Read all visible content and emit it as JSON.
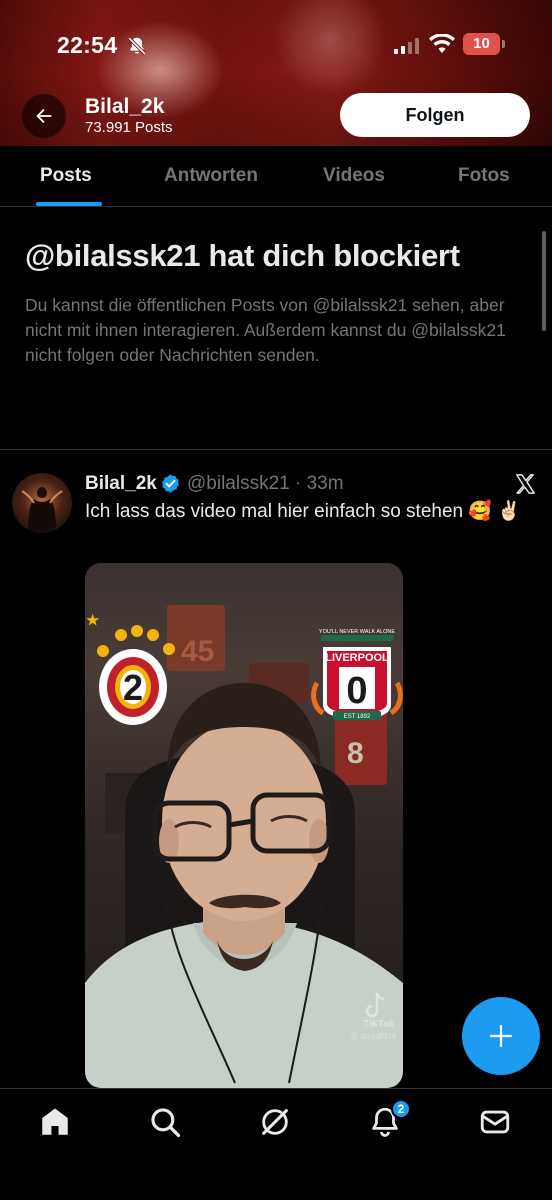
{
  "status_bar": {
    "time": "22:54",
    "battery": "10"
  },
  "header": {
    "name": "Bilal_2k",
    "post_count": "73.991 Posts",
    "follow_label": "Folgen"
  },
  "tabs": [
    {
      "label": "Posts",
      "active": true
    },
    {
      "label": "Antworten",
      "active": false
    },
    {
      "label": "Videos",
      "active": false
    },
    {
      "label": "Fotos",
      "active": false
    }
  ],
  "blocked": {
    "title": "@bilalssk21 hat dich blockiert",
    "text": "Du kannst die öffentlichen Posts von @bilalssk21 sehen, aber nicht mit ihnen interagieren. Außerdem kannst du @bilalssk21 nicht folgen oder Nachrichten senden."
  },
  "post": {
    "author": "Bilal_2k",
    "handle_time": "@bilalssk21 · 33m",
    "text": "Ich lass das video mal hier einfach so stehen 🥰 ✌🏻",
    "media": {
      "score_left": "2",
      "score_right": "0",
      "club_right": "LIVERPOOL",
      "motto": "YOU'LL NEVER WALK ALONE",
      "est": "EST 1892",
      "watermark": "TikTok",
      "watermark_user": "@ abdu9974",
      "bg_number": "45",
      "bg_number_2": "8"
    }
  },
  "bottom_nav": {
    "items": [
      "home-icon",
      "search-icon",
      "grok-icon",
      "notifications-icon",
      "messages-icon"
    ],
    "notification_badge": "2"
  },
  "colors": {
    "accent": "#1d9bf0",
    "background": "#000000",
    "muted": "#71767b",
    "banner": "#8c1a14"
  }
}
